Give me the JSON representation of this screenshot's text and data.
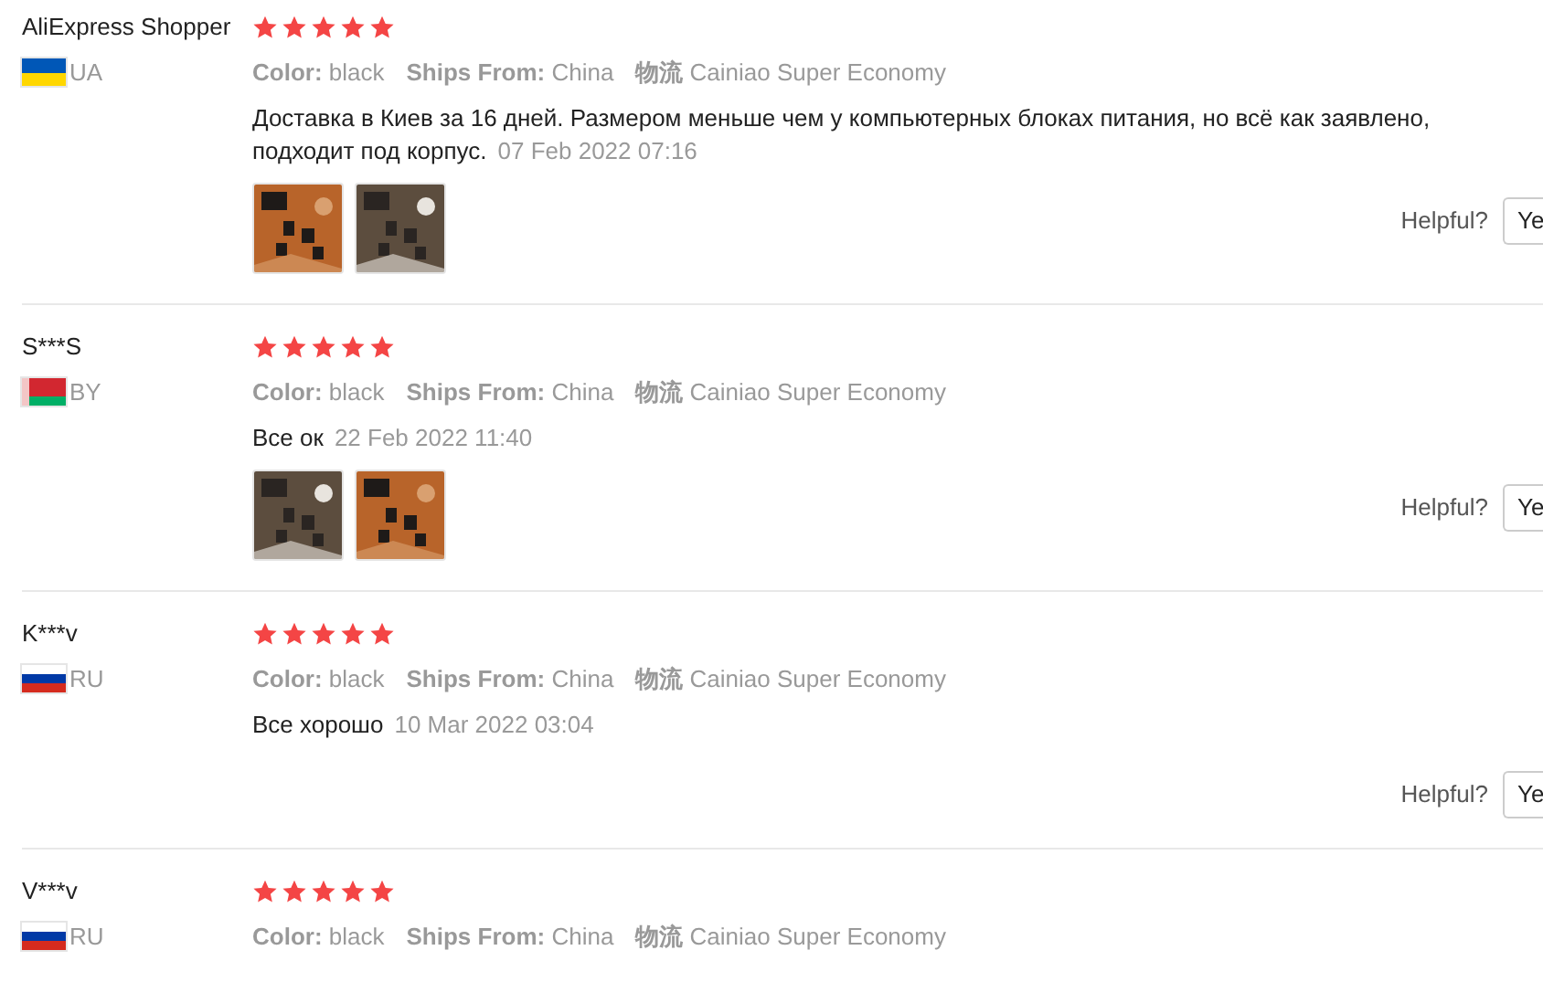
{
  "reviews": [
    {
      "name": "AliExpress Shopper",
      "country": "UA",
      "flag": {
        "kind": "two-band"
      },
      "stars": 5,
      "meta": [
        {
          "label": "Color:",
          "value": "black"
        },
        {
          "label": "Ships From:",
          "value": "China"
        },
        {
          "label": "物流",
          "value": "Cainiao Super Economy"
        }
      ],
      "text": "Доставка в Киев за 16 дней. Размером меньше чем у компьютерных блоках питания, но всё как заявлено, подходит под корпус.",
      "date": "07 Feb 2022 07:16",
      "photos": [
        {
          "kind": "picture"
        },
        {
          "kind": "picture"
        }
      ],
      "helpful": {
        "label": "Helpful?",
        "button": "Ye"
      }
    },
    {
      "name": "S***S",
      "country": "BY",
      "flag": {
        "kind": "ornament-band"
      },
      "stars": 5,
      "meta": [
        {
          "label": "Color:",
          "value": "black"
        },
        {
          "label": "Ships From:",
          "value": "China"
        },
        {
          "label": "物流",
          "value": "Cainiao Super Economy"
        }
      ],
      "text": "Все ок",
      "date": "22 Feb 2022 11:40",
      "photos": [
        {
          "kind": "picture"
        },
        {
          "kind": "picture"
        }
      ],
      "helpful": {
        "label": "Helpful?",
        "button": "Ye"
      }
    },
    {
      "name": "K***v",
      "country": "RU",
      "flag": {
        "kind": "tricolor"
      },
      "stars": 5,
      "meta": [
        {
          "label": "Color:",
          "value": "black"
        },
        {
          "label": "Ships From:",
          "value": "China"
        },
        {
          "label": "物流",
          "value": "Cainiao Super Economy"
        }
      ],
      "text": "Все хорошо",
      "date": "10 Mar 2022 03:04",
      "helpful": {
        "label": "Helpful?",
        "button": "Ye"
      }
    },
    {
      "name": "V***v",
      "country": "RU",
      "flag": {
        "kind": "tricolor"
      },
      "stars": 5,
      "meta": [
        {
          "label": "Color:",
          "value": "black"
        },
        {
          "label": "Ships From:",
          "value": "China"
        },
        {
          "label": "物流",
          "value": "Cainiao Super Economy"
        }
      ]
    }
  ]
}
